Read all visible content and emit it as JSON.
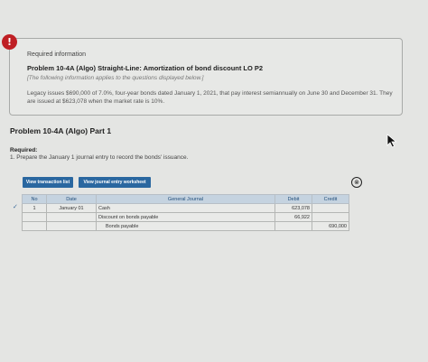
{
  "info": {
    "alert_icon": "!",
    "heading": "Required information",
    "title": "Problem 10-4A (Algo) Straight-Line: Amortization of bond discount LO P2",
    "note": "[The following information applies to the questions displayed below.]",
    "body": "Legacy issues $690,000 of 7.0%, four-year bonds dated January 1, 2021, that pay interest semiannually on June 30 and December 31. They are issued at $623,078 when the market rate is 10%."
  },
  "part": {
    "title": "Problem 10-4A (Algo) Part 1",
    "required_label": "Required:",
    "requirement": "1. Prepare the January 1 journal entry to record the bonds' issuance."
  },
  "buttons": {
    "view_transaction_list": "View transaction list",
    "view_journal_worksheet": "View journal entry worksheet"
  },
  "icons": {
    "close": "⊗",
    "check": "✓"
  },
  "journal": {
    "headers": {
      "no": "No",
      "date": "Date",
      "account": "General Journal",
      "debit": "Debit",
      "credit": "Credit"
    },
    "rows": [
      {
        "no": "1",
        "date": "January 01",
        "account": "Cash",
        "debit": "623,078",
        "credit": ""
      },
      {
        "no": "",
        "date": "",
        "account": "Discount on bonds payable",
        "debit": "66,922",
        "credit": ""
      },
      {
        "no": "",
        "date": "",
        "account": "Bonds payable",
        "debit": "",
        "credit": "690,000"
      }
    ]
  }
}
